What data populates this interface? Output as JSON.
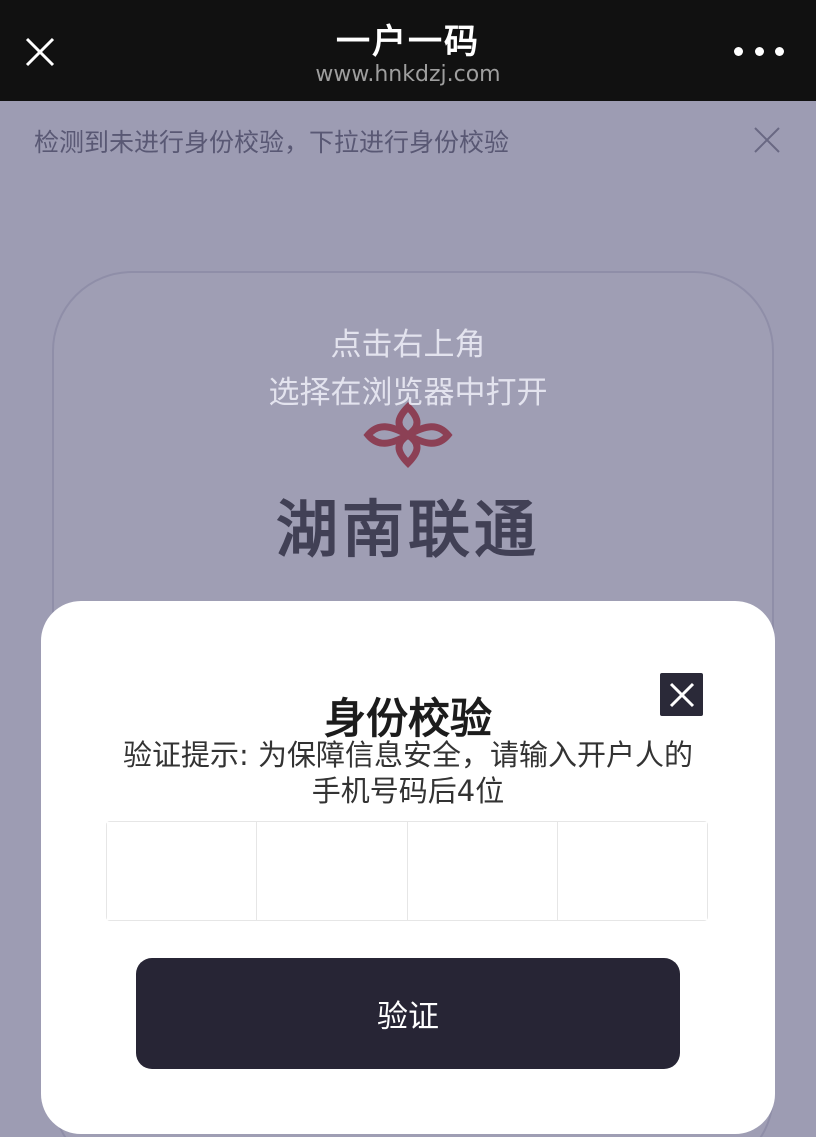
{
  "nav": {
    "title": "一户一码",
    "subtitle": "www.hnkdzj.com"
  },
  "background": {
    "notice": "检测到未进行身份校验，下拉进行身份校验",
    "brand": "湖南联通",
    "hint_line1": "点击右上角",
    "hint_line2": "选择在浏览器中打开"
  },
  "modal": {
    "title": "身份校验",
    "description_line1": "验证提示: 为保障信息安全，请输入开户人的",
    "description_line2": "手机号码后4位",
    "code_digits": [
      "",
      "",
      "",
      ""
    ],
    "verify_label": "验证"
  },
  "colors": {
    "nav_bg": "#111111",
    "button_bg": "#272535",
    "overlay": "#a09fb3",
    "logo": "#d23c3c"
  },
  "icons": [
    "close-icon",
    "more-icon",
    "china-unicom-logo"
  ]
}
